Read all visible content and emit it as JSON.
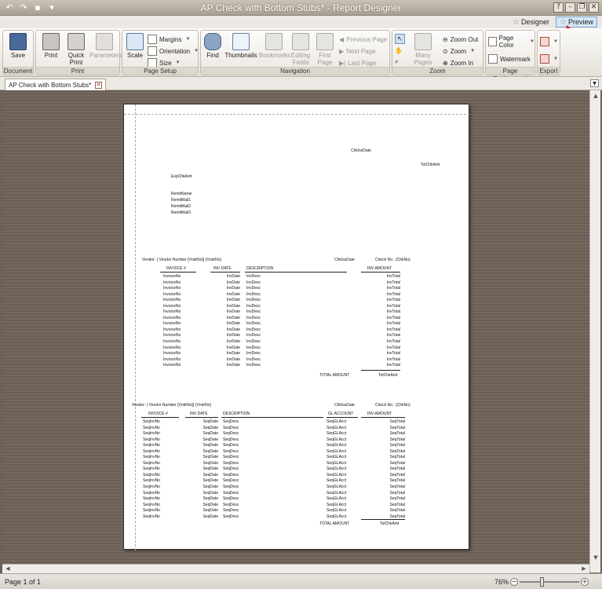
{
  "window": {
    "title": "AP Check with Bottom Stubs* - Report Designer",
    "qat_icons": [
      "undo-icon",
      "redo-icon",
      "save-icon",
      "customize-icon"
    ],
    "controls": [
      "help-icon",
      "minimize-icon",
      "restore-icon",
      "close-icon"
    ]
  },
  "view_tabs": [
    {
      "label": "Designer",
      "active": false
    },
    {
      "label": "Preview",
      "active": true
    }
  ],
  "ribbon": {
    "document": {
      "label": "Document",
      "save": "Save"
    },
    "print": {
      "label": "Print",
      "print": "Print",
      "quick_print": "Quick Print",
      "parameters": "Parameters"
    },
    "page_setup": {
      "label": "Page Setup",
      "scale": "Scale",
      "margins": "Margins",
      "orientation": "Orientation",
      "size": "Size"
    },
    "navigation": {
      "label": "Navigation",
      "find": "Find",
      "thumbnails": "Thumbnails",
      "bookmarks": "Bookmarks",
      "editing_fields": "Editing Fields",
      "first_page": "First Page",
      "previous_page": "Previous Page",
      "next_page": "Next Page",
      "last_page": "Last Page"
    },
    "zoom": {
      "label": "Zoom",
      "many_pages": "Many Pages",
      "zoom_out": "Zoom Out",
      "zoom": "Zoom",
      "zoom_in": "Zoom In"
    },
    "page_background": {
      "label": "Page Background",
      "page_color": "Page Color",
      "watermark": "Watermark"
    },
    "export": {
      "label": "Export"
    }
  },
  "doc_tab": {
    "label": "AP Check with Bottom Stubs*"
  },
  "report": {
    "check_date": "ChkIssDate",
    "total_amount": "TotChkAmt",
    "exp_amount": "ExpChkAmt",
    "remit": [
      "RemitName",
      "RemitMail1",
      "RemitMail2",
      "RemitMail3"
    ],
    "stub1": {
      "vendor": "Vendor: { Vendor Number [VndrNo]}  {VndrNo}",
      "date": "ChkIssDate",
      "check_no": "Check No.: {ChkNo}",
      "headers": [
        "INVOICE #",
        "INV DATE",
        "DESCRIPTION",
        "INV AMOUNT"
      ],
      "rows": 16,
      "cells": [
        "InvoiceNo",
        "InvDate",
        "InvDesc",
        "InvTotal"
      ],
      "total_label": "TOTAL AMOUNT",
      "total_value": "TotChkAmt"
    },
    "stub2": {
      "vendor": "Vendor: { Vendor Number [VndrNo]}  {VndrNo}",
      "date": "ChkIssDate",
      "check_no": "Check No.: {ChkNo}",
      "headers": [
        "INVOICE #",
        "INV DATE",
        "DESCRIPTION",
        "GL ACCOUNT",
        "INV AMOUNT"
      ],
      "rows": 17,
      "cells": [
        "SeqInvNo",
        "SeqDate",
        "SeqDesc",
        "SeqGLAcct",
        "SeqTotal"
      ],
      "total_label": "TOTAL AMOUNT",
      "total_value": "TotChkAmt"
    }
  },
  "status": {
    "page": "Page 1 of 1",
    "zoom": "76%",
    "zoom_fraction": 0.76
  }
}
